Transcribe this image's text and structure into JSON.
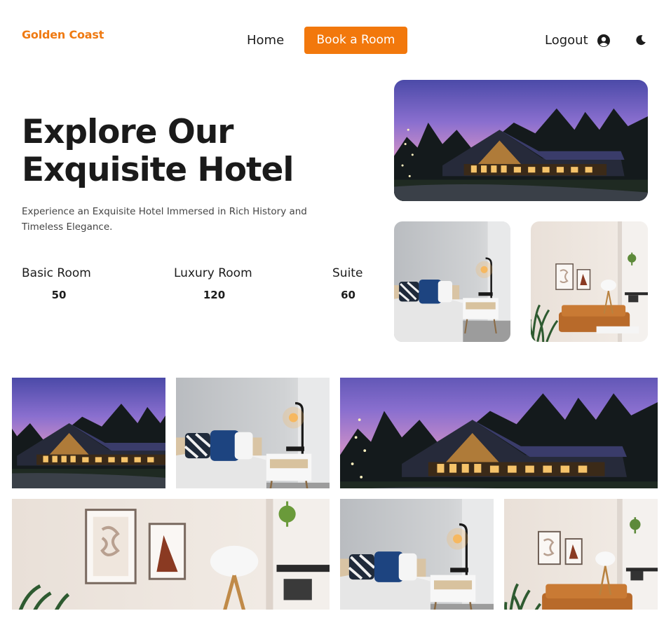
{
  "header": {
    "brand": "Golden Coast",
    "nav_home": "Home",
    "book_button": "Book a Room",
    "logout": "Logout",
    "icons": [
      "user-circle-icon",
      "moon-icon"
    ]
  },
  "hero": {
    "title": "Explore Our Exquisite Hotel",
    "subtitle": "Experience an Exquisite Hotel Immersed in Rich History and Timeless Elegance."
  },
  "stats": [
    {
      "label": "Basic Room",
      "value": "50"
    },
    {
      "label": "Luxury Room",
      "value": "120"
    },
    {
      "label": "Suite",
      "value": "60"
    }
  ],
  "colors": {
    "accent": "#f2780c",
    "brand": "#ef7a12",
    "text": "#1c1c1c"
  }
}
